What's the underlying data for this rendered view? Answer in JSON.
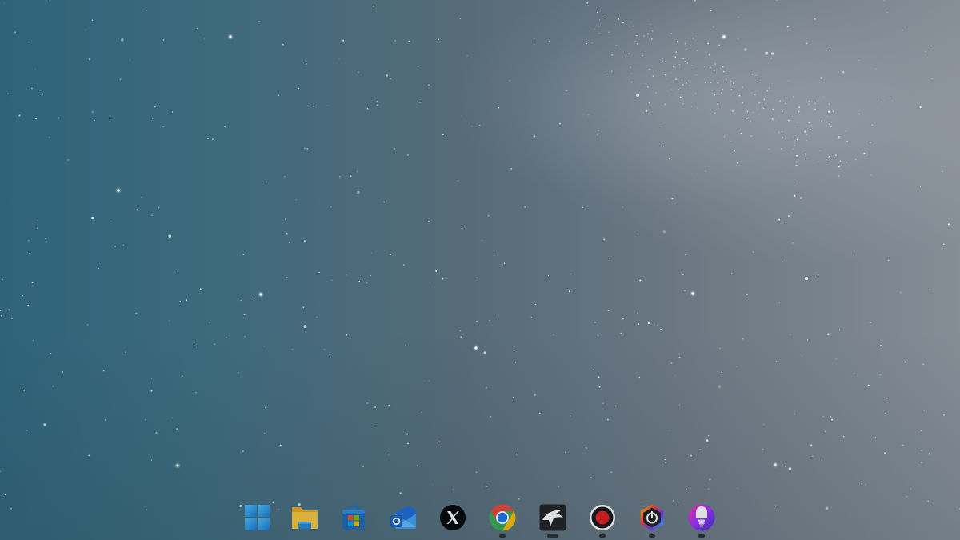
{
  "desktop": {
    "wallpaper": "starry-sky",
    "colors": {
      "sky_left": "#2f6379",
      "sky_right": "#858d95",
      "indicator": "#262a2e"
    }
  },
  "taskbar": {
    "items": [
      {
        "name": "start",
        "icon": "windows-logo-icon",
        "running": false
      },
      {
        "name": "file-explorer",
        "icon": "folder-icon",
        "running": false
      },
      {
        "name": "microsoft-store",
        "icon": "store-bag-icon",
        "running": false
      },
      {
        "name": "outlook",
        "icon": "outlook-icon",
        "running": false
      },
      {
        "name": "x",
        "icon": "x-logo-icon",
        "running": false
      },
      {
        "name": "chrome",
        "icon": "chrome-icon",
        "running": true
      },
      {
        "name": "eagle-app",
        "icon": "eagle-icon",
        "running": true
      },
      {
        "name": "screen-recorder",
        "icon": "record-icon",
        "running": true
      },
      {
        "name": "gaming-app",
        "icon": "hexagon-power-icon",
        "running": true
      },
      {
        "name": "smart-light-app",
        "icon": "light-bulb-icon",
        "running": true
      }
    ]
  }
}
